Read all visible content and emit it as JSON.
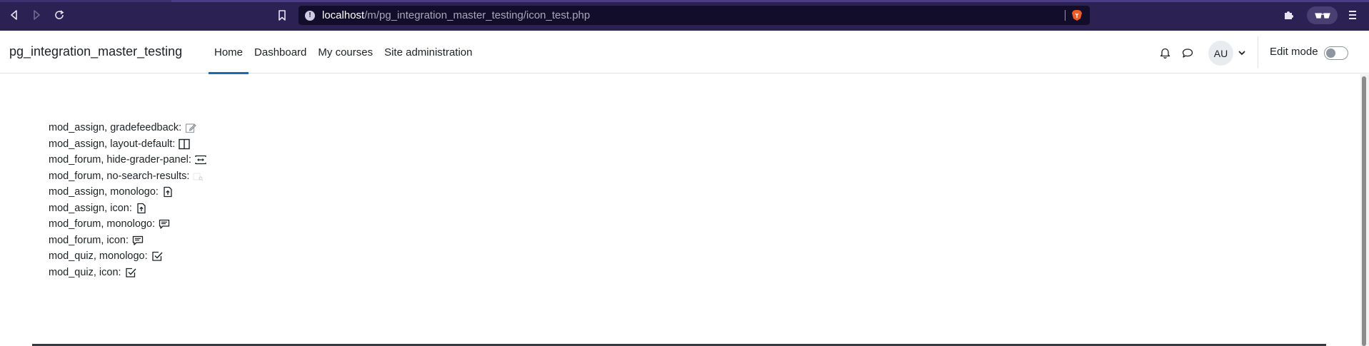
{
  "browser": {
    "url_host": "localhost",
    "url_path": "/m/pg_integration_master_testing/icon_test.php"
  },
  "navbar": {
    "site_name": "pg_integration_master_testing",
    "items": [
      {
        "label": "Home",
        "active": true
      },
      {
        "label": "Dashboard",
        "active": false
      },
      {
        "label": "My courses",
        "active": false
      },
      {
        "label": "Site administration",
        "active": false
      }
    ],
    "avatar_initials": "AU",
    "edit_mode_label": "Edit mode",
    "edit_mode_on": false
  },
  "icons": [
    {
      "label": "mod_assign, gradefeedback:",
      "icon": "edit-grade-icon"
    },
    {
      "label": "mod_assign, layout-default:",
      "icon": "layout-columns-icon"
    },
    {
      "label": "mod_forum, hide-grader-panel:",
      "icon": "expand-horizontal-icon"
    },
    {
      "label": "mod_forum, no-search-results:",
      "icon": "search-faint-icon"
    },
    {
      "label": "mod_assign, monologo:",
      "icon": "assignment-file-icon"
    },
    {
      "label": "mod_assign, icon:",
      "icon": "assignment-file-icon"
    },
    {
      "label": "mod_forum, monologo:",
      "icon": "forum-chat-icon"
    },
    {
      "label": "mod_forum, icon:",
      "icon": "forum-chat-icon"
    },
    {
      "label": "mod_quiz, monologo:",
      "icon": "quiz-check-icon"
    },
    {
      "label": "mod_quiz, icon:",
      "icon": "quiz-check-icon"
    }
  ],
  "colors": {
    "browser_bg": "#2b2253",
    "primary": "#0f6cbf",
    "text": "#1d2125"
  }
}
